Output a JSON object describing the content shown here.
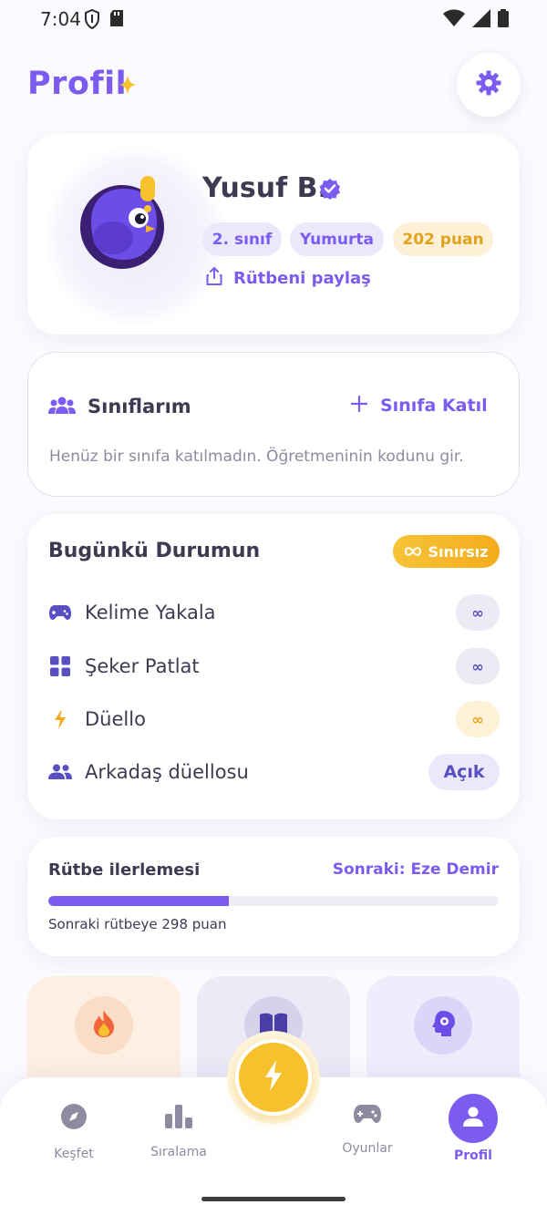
{
  "status_bar": {
    "time": "7:04"
  },
  "header": {
    "title": "Profil"
  },
  "profile": {
    "name": "Yusuf B.",
    "grade": "2. sınıf",
    "rank": "Yumurta",
    "points": "202 puan",
    "share_label": "Rütbeni paylaş"
  },
  "classes": {
    "title": "Sınıflarım",
    "join_label": "Sınıfa Katıl",
    "empty_text": "Henüz bir sınıfa katılmadın. Öğretmeninin kodunu gir."
  },
  "today": {
    "title": "Bugünkü Durumun",
    "badge": "Sınırsız",
    "games": [
      {
        "label": "Kelime Yakala",
        "value": "∞",
        "icon": "gamepad-icon"
      },
      {
        "label": "Şeker Patlat",
        "value": "∞",
        "icon": "grid-icon"
      },
      {
        "label": "Düello",
        "value": "∞",
        "icon": "lightning-icon"
      },
      {
        "label": "Arkadaş düellosu",
        "value": "Açık",
        "icon": "friends-icon"
      }
    ]
  },
  "rank_progress": {
    "title": "Rütbe ilerlemesi",
    "next": "Sonraki: Eze Demir",
    "caption": "Sonraki rütbeye 298 puan",
    "fraction": 0.4
  },
  "tiles": [
    {
      "icon": "fire-icon"
    },
    {
      "icon": "book-icon"
    },
    {
      "icon": "brain-gear-icon"
    }
  ],
  "nav": {
    "items": [
      {
        "label": "Keşfet",
        "icon": "compass-icon"
      },
      {
        "label": "Sıralama",
        "icon": "bar-chart-icon"
      },
      {
        "label": "Oyunlar",
        "icon": "gamepad-icon"
      },
      {
        "label": "Profil",
        "icon": "person-icon"
      }
    ],
    "active": "Profil"
  },
  "colors": {
    "accent": "#7c5cf0",
    "gold": "#f7c12e",
    "text": "#3d3b52",
    "muted": "#8d8b9f"
  }
}
